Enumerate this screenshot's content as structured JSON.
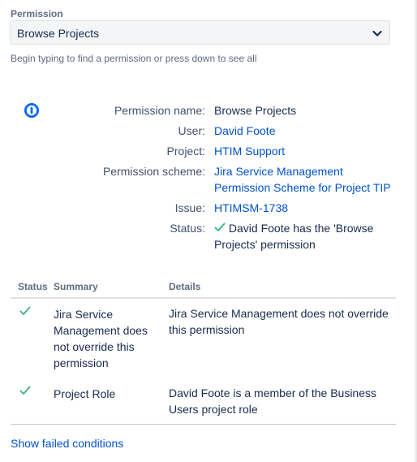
{
  "permission_field": {
    "label": "Permission",
    "selected": "Browse Projects",
    "hint": "Begin typing to find a permission or press down to see all"
  },
  "summary": {
    "permission_name_label": "Permission name:",
    "permission_name_value": "Browse Projects",
    "user_label": "User:",
    "user_value": "David Foote",
    "project_label": "Project:",
    "project_value": "HTIM Support",
    "scheme_label": "Permission scheme:",
    "scheme_value_line1": "Jira Service Management",
    "scheme_value_line2": "Permission Scheme for Project TIP",
    "issue_label": "Issue:",
    "issue_value": "HTIMSM-1738",
    "status_label": "Status:",
    "status_value_line1": "David Foote has the 'Browse",
    "status_value_line2": "Projects' permission"
  },
  "table": {
    "headers": {
      "status": "Status",
      "summary": "Summary",
      "details": "Details"
    },
    "rows": [
      {
        "summary_lines": [
          "Jira Service",
          "Management does",
          "not override this",
          "permission"
        ],
        "details_lines": [
          "Jira Service Management does not override",
          "this permission"
        ]
      },
      {
        "summary_lines": [
          "Project Role"
        ],
        "details_lines": [
          "David Foote is a member of the Business",
          "Users project role"
        ]
      }
    ]
  },
  "footer": {
    "show_failed": "Show failed conditions"
  },
  "colors": {
    "link": "#0052cc",
    "success": "#36b37e",
    "info": "#0065ff"
  },
  "icons": {
    "select_chevron": "chevron-down-icon",
    "info": "info-icon",
    "status_check": "check-icon"
  }
}
